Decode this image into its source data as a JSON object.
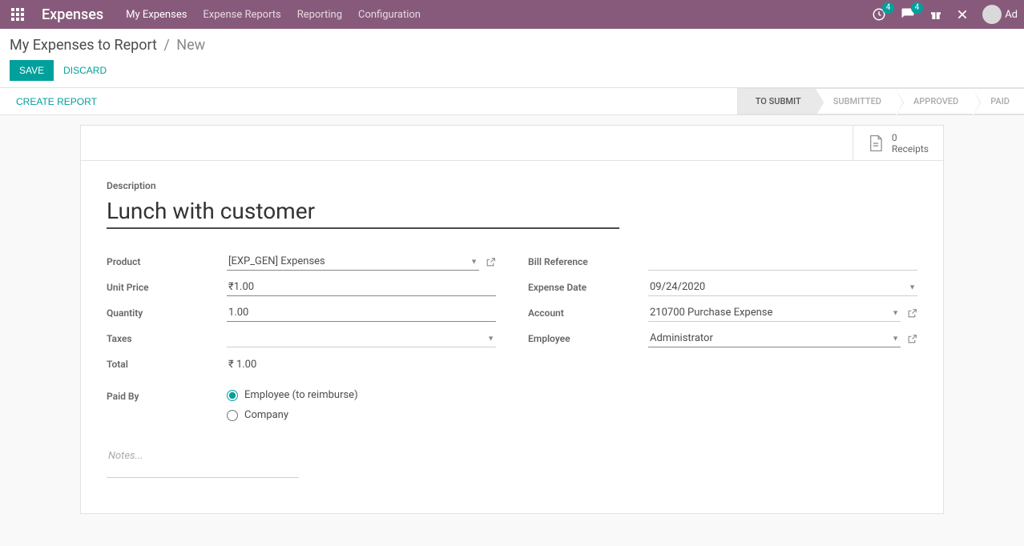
{
  "nav": {
    "brand": "Expenses",
    "links": [
      "My Expenses",
      "Expense Reports",
      "Reporting",
      "Configuration"
    ],
    "notif_badge": "4",
    "msg_badge": "4",
    "user_short": "Ad"
  },
  "breadcrumb": {
    "root": "My Expenses to Report",
    "current": "New"
  },
  "actions": {
    "save": "SAVE",
    "discard": "DISCARD",
    "create_report": "CREATE REPORT"
  },
  "statusbar": [
    "TO SUBMIT",
    "SUBMITTED",
    "APPROVED",
    "PAID"
  ],
  "receipts": {
    "count": "0",
    "label": "Receipts"
  },
  "form": {
    "description_label": "Description",
    "description_value": "Lunch with customer",
    "left": {
      "product_label": "Product",
      "product_value": "[EXP_GEN] Expenses",
      "unit_price_label": "Unit Price",
      "unit_price_value": "₹1.00",
      "quantity_label": "Quantity",
      "quantity_value": "1.00",
      "taxes_label": "Taxes",
      "taxes_value": "",
      "total_label": "Total",
      "total_value": "₹ 1.00"
    },
    "right": {
      "bill_ref_label": "Bill Reference",
      "bill_ref_value": "",
      "expense_date_label": "Expense Date",
      "expense_date_value": "09/24/2020",
      "account_label": "Account",
      "account_value": "210700 Purchase Expense",
      "employee_label": "Employee",
      "employee_value": "Administrator"
    },
    "paid_by_label": "Paid By",
    "paid_by_options": {
      "employee": "Employee (to reimburse)",
      "company": "Company"
    },
    "notes_placeholder": "Notes..."
  }
}
